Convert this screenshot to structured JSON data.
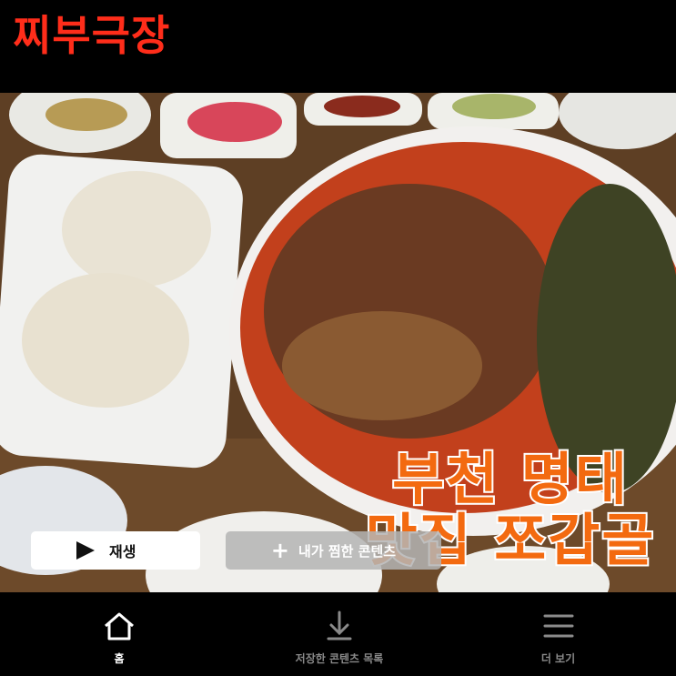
{
  "header": {
    "brand": "찌부극장"
  },
  "hero": {
    "title_line1": "부천 명태",
    "title_line2": "맛집 쪼갑골",
    "title_color": "#f36a10",
    "image_icon": "food-photo"
  },
  "actions": {
    "play_label": "재생",
    "play_icon": "play-icon",
    "favorite_label": "내가 찜한 콘텐츠",
    "favorite_icon": "plus-icon"
  },
  "bottom_nav": {
    "items": [
      {
        "label": "홈",
        "icon": "home-icon",
        "active": true
      },
      {
        "label": "저장한 콘텐츠 목록",
        "icon": "download-icon",
        "active": false
      },
      {
        "label": "더 보기",
        "icon": "menu-icon",
        "active": false
      }
    ]
  },
  "colors": {
    "brand": "#ff2d1a",
    "background": "#000000"
  }
}
